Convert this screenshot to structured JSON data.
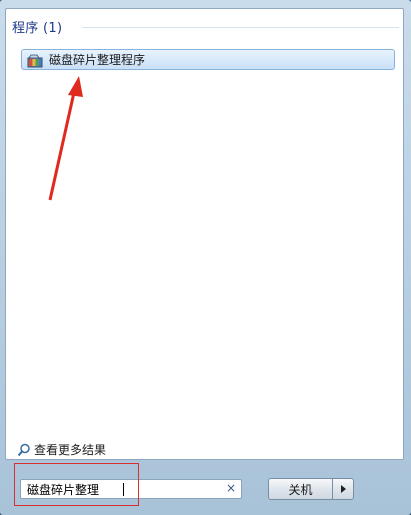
{
  "programs": {
    "header": "程序 (1)",
    "items": [
      {
        "label": "磁盘碎片整理程序",
        "icon": "disk-defragmenter-icon"
      }
    ]
  },
  "more_results": {
    "label": "查看更多结果",
    "icon": "magnifier-icon"
  },
  "search": {
    "value": "磁盘碎片整理",
    "clear_label": "×"
  },
  "shutdown": {
    "label": "关机",
    "arrow_icon": "triangle-right-icon"
  },
  "colors": {
    "annotation_red": "#d9302f",
    "highlight_blue": "#86b2dc"
  }
}
